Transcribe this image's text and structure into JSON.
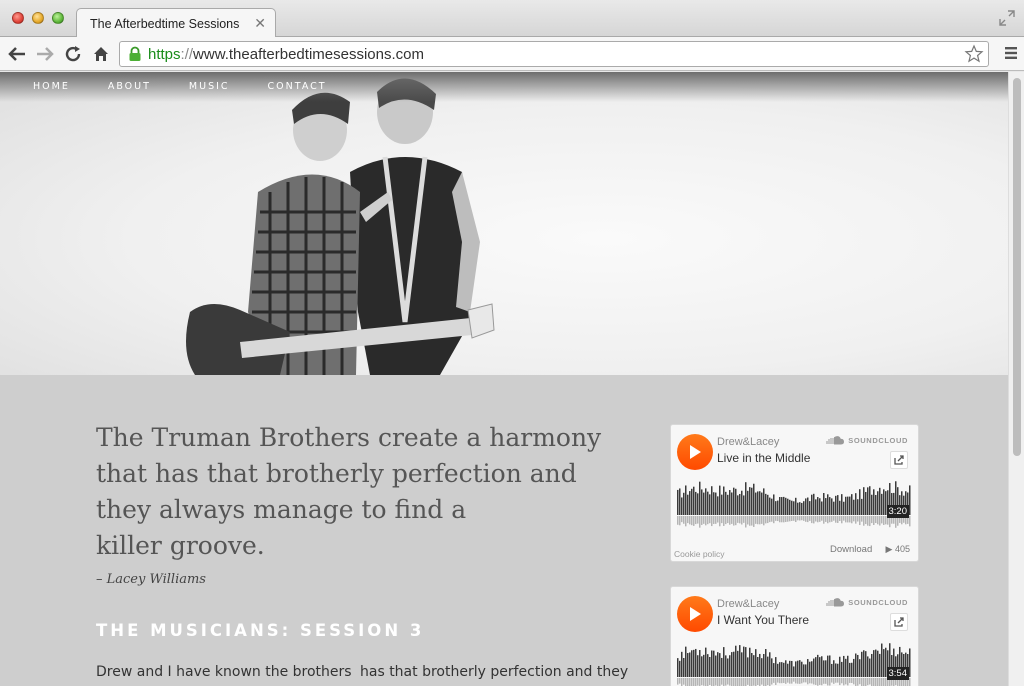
{
  "browser": {
    "tab_title": "The Afterbedtime Sessions",
    "url_scheme": "https",
    "url_sep": "://",
    "url_host": "www.theafterbedtimesessions.com"
  },
  "nav": {
    "items": [
      "HOME",
      "ABOUT",
      "MUSIC",
      "CONTACT"
    ]
  },
  "quote": {
    "lines": [
      "The Truman Brothers create a harmony",
      "that has that brotherly perfection and",
      "they always manage to find a",
      "killer groove."
    ],
    "author": "– Lacey Williams"
  },
  "section": {
    "title": "THE MUSICIANS: SESSION 3",
    "col1": "Drew and I have known the brothers",
    "col2": "has that brotherly perfection and they"
  },
  "players": [
    {
      "artist": "Drew&Lacey",
      "track": "Live in the Middle",
      "duration": "3:20",
      "cookie": "Cookie policy",
      "download": "Download",
      "plays": "405",
      "brand": "SOUNDCLOUD"
    },
    {
      "artist": "Drew&Lacey",
      "track": "I Want You There",
      "duration": "3:54",
      "brand": "SOUNDCLOUD"
    }
  ],
  "colors": {
    "soundcloud_orange": "#ff5500",
    "secure_green": "#1a8c1a",
    "body_bg": "#cecece"
  }
}
